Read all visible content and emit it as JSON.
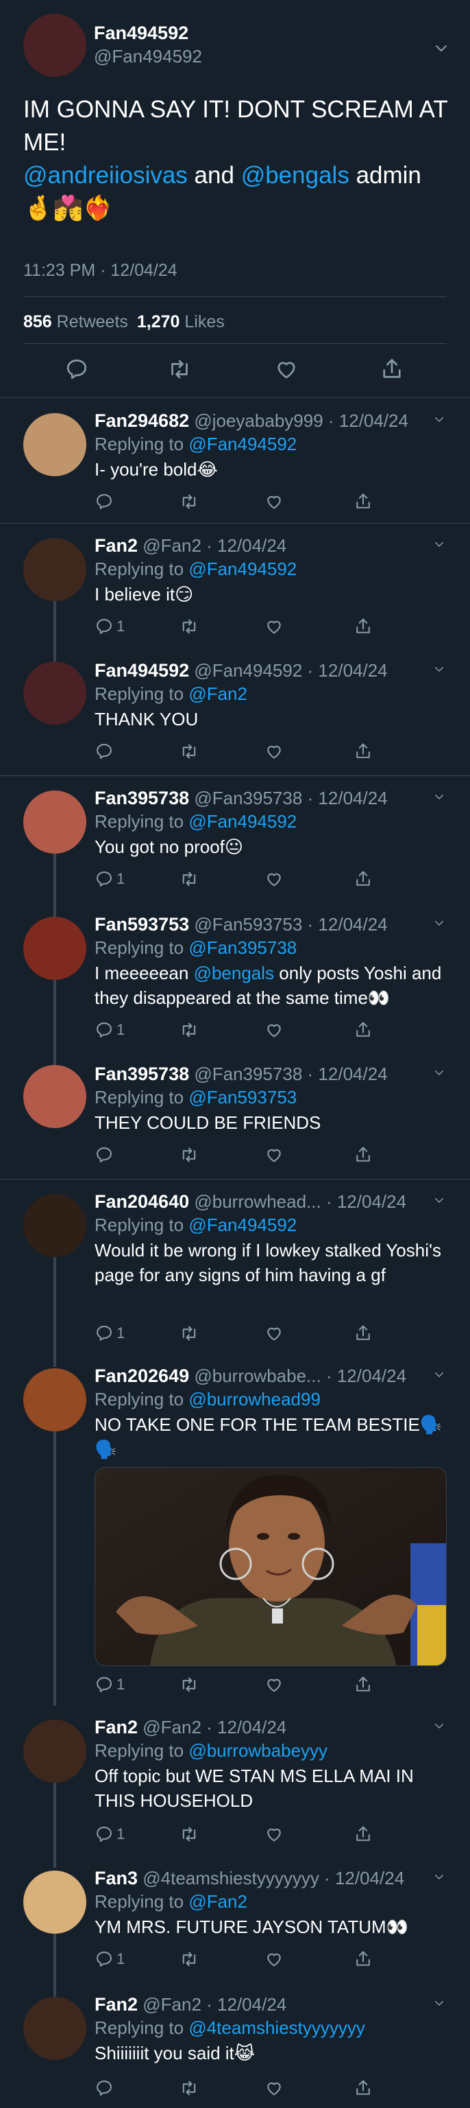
{
  "main": {
    "name": "Fan494592",
    "handle": "@Fan494592",
    "text_line1": "IM GONNA SAY IT! DONT SCREAM AT ME!",
    "mention1": "@andreiiosivas",
    "and_text": "and",
    "mention2": "@bengals",
    "after": "admin",
    "emojis": "🤞💏❤️‍🔥",
    "time": "11:23 PM · 12/04/24",
    "retweets_count": "856",
    "retweets_label": "Retweets",
    "likes_count": "1,270",
    "likes_label": "Likes",
    "avatar_color": "#4a2226"
  },
  "replying_label": "Replying to",
  "replies": [
    {
      "name": "Fan294682",
      "handle": "@joeyababy999",
      "date": "· 12/04/24",
      "replying_to": "@Fan494592",
      "text": "I- you're bold😂",
      "reply_count": "",
      "avatar_color": "#c0956b"
    },
    {
      "name": "Fan2",
      "handle": "@Fan2",
      "date": "· 12/04/24",
      "replying_to": "@Fan494592",
      "text": "I believe it😏",
      "reply_count": "1",
      "avatar_color": "#3e271d"
    },
    {
      "name": "Fan494592",
      "handle": "@Fan494592",
      "date": "· 12/04/24",
      "replying_to": "@Fan2",
      "text": "THANK YOU",
      "reply_count": "",
      "avatar_color": "#4a2226"
    },
    {
      "name": "Fan395738",
      "handle": "@Fan395738",
      "date": "· 12/04/24",
      "replying_to": "@Fan494592",
      "text": "You got no proof😐",
      "reply_count": "1",
      "avatar_color": "#b35a4b"
    },
    {
      "name": "Fan593753",
      "handle": "@Fan593753",
      "date": "· 12/04/24",
      "replying_to": "@Fan395738",
      "text_a": "I meeeeean",
      "mention": "@bengals",
      "text_b": "only posts Yoshi and they disappeared at the same time👀",
      "reply_count": "1",
      "avatar_color": "#7e2a1f"
    },
    {
      "name": "Fan395738",
      "handle": "@Fan395738",
      "date": "· 12/04/24",
      "replying_to": "@Fan593753",
      "text": "THEY COULD BE FRIENDS",
      "reply_count": "",
      "avatar_color": "#b35a4b"
    },
    {
      "name": "Fan204640",
      "handle": "@burrowhead...",
      "date": "· 12/04/24",
      "replying_to": "@Fan494592",
      "text": "Would it be wrong if I lowkey stalked Yoshi's page for any signs of him having a gf",
      "reply_count": "1",
      "avatar_color": "#2e1f17"
    },
    {
      "name": "Fan202649",
      "handle": "@burrowbabe...",
      "date": "· 12/04/24",
      "replying_to": "@burrowhead99",
      "text": "NO TAKE ONE FOR THE TEAM BESTIE🗣️🗣️",
      "reply_count": "1",
      "avatar_color": "#944a22"
    },
    {
      "name": "Fan2",
      "handle": "@Fan2",
      "date": "· 12/04/24",
      "replying_to": "@burrowbabeyyy",
      "text": "Off topic but WE STAN MS ELLA MAI IN THIS HOUSEHOLD",
      "reply_count": "1",
      "avatar_color": "#3e271d"
    },
    {
      "name": "Fan3",
      "handle": "@4teamshiestyyyyyyy",
      "date": "· 12/04/24",
      "replying_to": "@Fan2",
      "text": "YM MRS. FUTURE JAYSON TATUM👀",
      "reply_count": "1",
      "avatar_color": "#d8b07a"
    },
    {
      "name": "Fan2",
      "handle": "@Fan2",
      "date": "· 12/04/24",
      "replying_to": "@4teamshiestyyyyyyy",
      "text": "Shiiiiiiit you said it😹",
      "reply_count": "",
      "avatar_color": "#3e271d"
    }
  ],
  "icons": [
    "chevron-down-icon",
    "reply-icon",
    "retweet-icon",
    "like-icon",
    "share-icon"
  ],
  "colors": {
    "background": "#15202b",
    "link": "#1da1f2",
    "muted": "#8899a6",
    "divider": "#38444d"
  }
}
